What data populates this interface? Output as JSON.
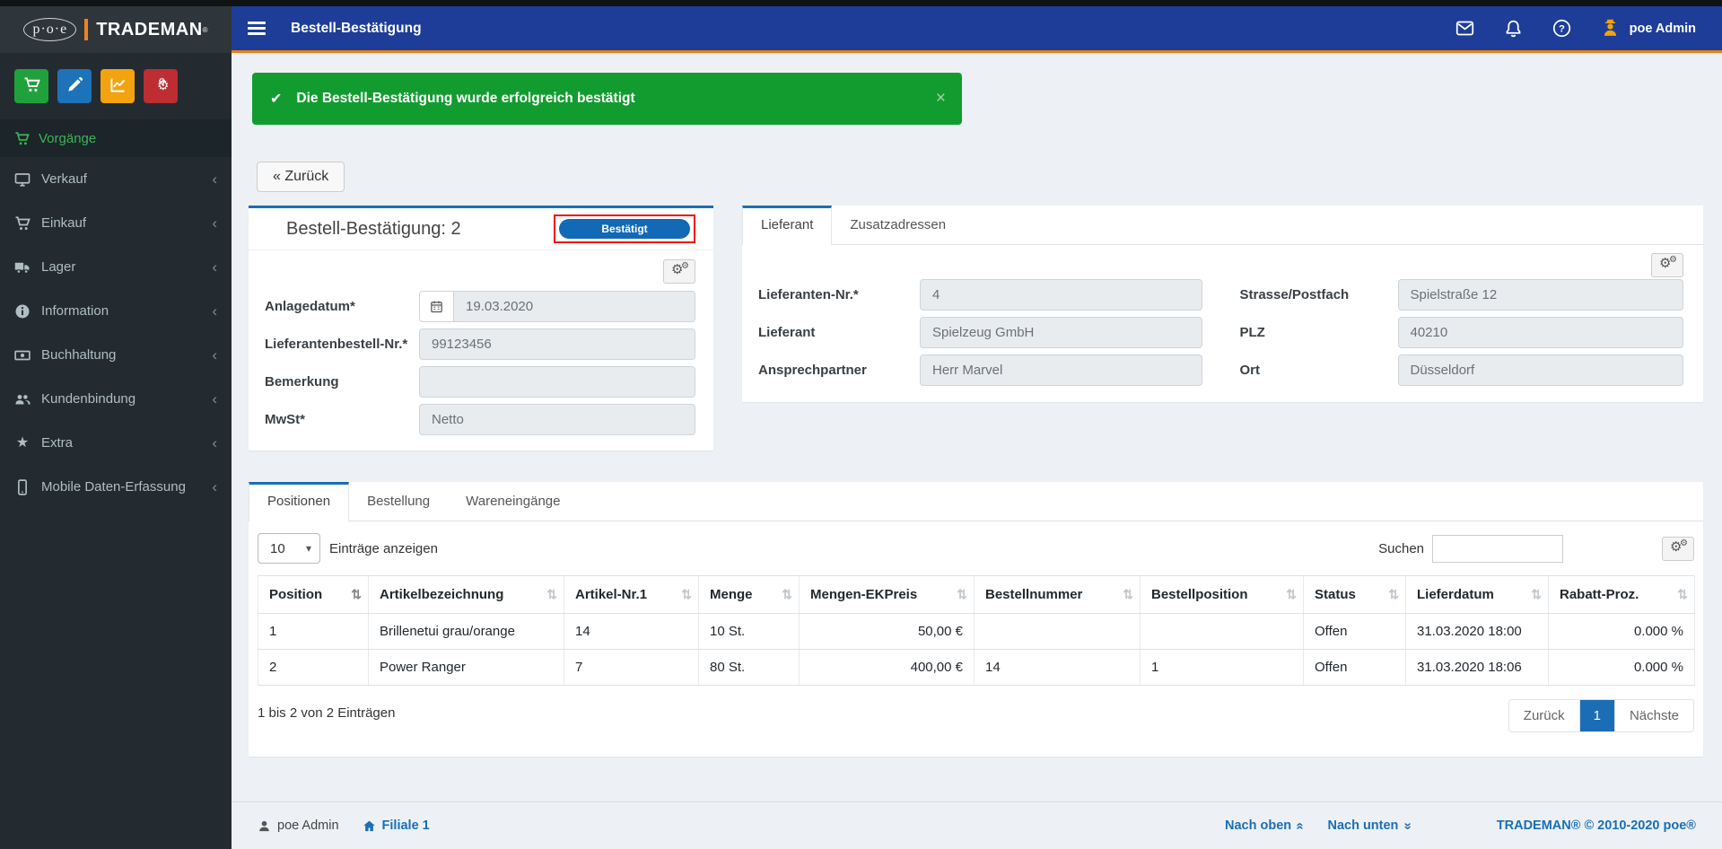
{
  "colors": {
    "accent": "#1b6eb5",
    "header_blue": "#1e3d98",
    "header_orange": "#e87f16",
    "success_green": "#129c30",
    "sidebar_dark": "#232b31",
    "badge_outline_red": "#ef1111",
    "avatar_orange": "#f0a30a"
  },
  "logo": {
    "poe": "p·o·e",
    "brand": "TRADEMAN",
    "registered": "®"
  },
  "header": {
    "title": "Bestell-Bestätigung",
    "user": "poe Admin",
    "icons": [
      "envelope-icon",
      "bell-icon",
      "question-icon",
      "avatar-icon"
    ]
  },
  "sidebar": {
    "quick_buttons": [
      {
        "icon": "cart-icon",
        "color": "#1fa23c"
      },
      {
        "icon": "pencil-icon",
        "color": "#1d72b8"
      },
      {
        "icon": "chart-line-icon",
        "color": "#f2a30f"
      },
      {
        "icon": "gears-icon",
        "color": "#bd2d32"
      }
    ],
    "active_item": {
      "icon": "cart-icon",
      "label": "Vorgänge"
    },
    "items": [
      {
        "icon": "desktop-icon",
        "label": "Verkauf"
      },
      {
        "icon": "cart-icon",
        "label": "Einkauf"
      },
      {
        "icon": "truck-icon",
        "label": "Lager"
      },
      {
        "icon": "info-icon",
        "label": "Information"
      },
      {
        "icon": "money-icon",
        "label": "Buchhaltung"
      },
      {
        "icon": "users-icon",
        "label": "Kundenbindung"
      },
      {
        "icon": "star-icon",
        "label": "Extra"
      },
      {
        "icon": "mobile-icon",
        "label": "Mobile Daten-Erfassung"
      }
    ]
  },
  "alert": {
    "message": "Die Bestell-Bestätigung wurde erfolgreich bestätigt",
    "close": "×"
  },
  "back_button": "« Zurück",
  "order_panel": {
    "title": "Bestell-Bestätigung: 2",
    "status_badge": "Bestätigt",
    "fields": [
      {
        "label": "Anlagedatum*",
        "value": "19.03.2020",
        "prepend_icon": "calendar-icon"
      },
      {
        "label": "Lieferantenbestell-Nr.*",
        "value": "99123456"
      },
      {
        "label": "Bemerkung",
        "value": ""
      },
      {
        "label": "MwSt*",
        "value": "Netto"
      }
    ]
  },
  "supplier_panel": {
    "tabs": [
      {
        "label": "Lieferant",
        "active": true
      },
      {
        "label": "Zusatzadressen",
        "active": false
      }
    ],
    "fields_left": [
      {
        "label": "Lieferanten-Nr.*",
        "value": "4"
      },
      {
        "label": "Lieferant",
        "value": "Spielzeug GmbH"
      },
      {
        "label": "Ansprechpartner",
        "value": "Herr Marvel"
      }
    ],
    "fields_right": [
      {
        "label": "Strasse/Postfach",
        "value": "Spielstraße 12"
      },
      {
        "label": "PLZ",
        "value": "40210"
      },
      {
        "label": "Ort",
        "value": "Düsseldorf"
      }
    ]
  },
  "positions_panel": {
    "tabs": [
      {
        "label": "Positionen",
        "active": true
      },
      {
        "label": "Bestellung",
        "active": false
      },
      {
        "label": "Wareneingänge",
        "active": false
      }
    ],
    "page_length": {
      "value": "10",
      "label": "Einträge anzeigen"
    },
    "search": {
      "label": "Suchen",
      "value": ""
    },
    "table": {
      "columns": [
        "Position",
        "Artikelbezeichnung",
        "Artikel-Nr.1",
        "Menge",
        "Mengen-EKPreis",
        "Bestellnummer",
        "Bestellposition",
        "Status",
        "Lieferdatum",
        "Rabatt-Proz."
      ],
      "rows": [
        {
          "cells": [
            "1",
            "Brillenetui grau/orange",
            "14",
            "10 St.",
            "50,00 €",
            "",
            "",
            "Offen",
            "31.03.2020 18:00",
            "0.000 %"
          ]
        },
        {
          "cells": [
            "2",
            "Power Ranger",
            "7",
            "80 St.",
            "400,00 €",
            "14",
            "1",
            "Offen",
            "31.03.2020 18:06",
            "0.000 %"
          ]
        }
      ]
    },
    "info": "1 bis 2 von 2 Einträgen",
    "pagination": {
      "prev": "Zurück",
      "page": "1",
      "next": "Nächste"
    }
  },
  "footer": {
    "user": "poe Admin",
    "branch": "Filiale 1",
    "up": "Nach oben",
    "down": "Nach unten",
    "copyright": "TRADEMAN® © 2010-2020 poe®"
  }
}
